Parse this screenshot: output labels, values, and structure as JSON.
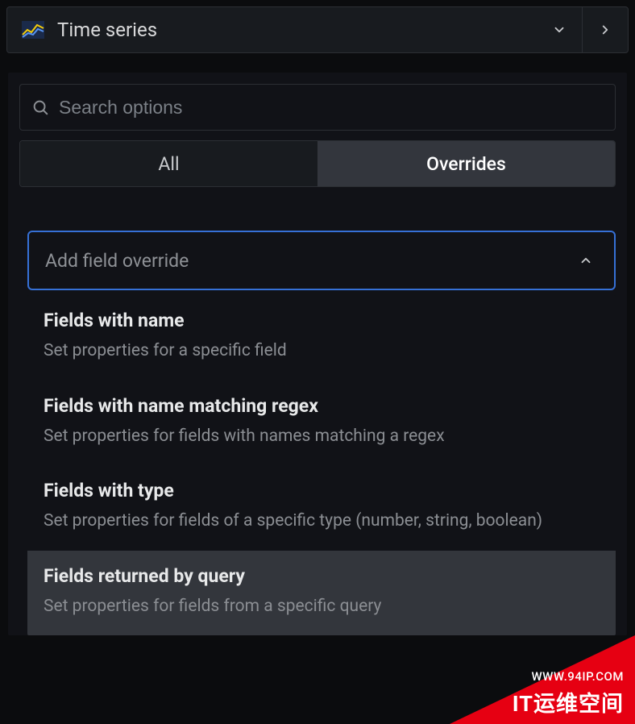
{
  "header": {
    "visualization_label": "Time series"
  },
  "search": {
    "placeholder": "Search options"
  },
  "tabs": {
    "all": "All",
    "overrides": "Overrides"
  },
  "override_dropdown": {
    "label": "Add field override",
    "items": [
      {
        "title": "Fields with name",
        "desc": "Set properties for a specific field"
      },
      {
        "title": "Fields with name matching regex",
        "desc": "Set properties for fields with names matching a regex"
      },
      {
        "title": "Fields with type",
        "desc": "Set properties for fields of a specific type (number, string, boolean)"
      },
      {
        "title": "Fields returned by query",
        "desc": "Set properties for fields from a specific query"
      }
    ]
  },
  "watermark": {
    "url": "WWW.94IP.COM",
    "main": "IT运维空间"
  }
}
